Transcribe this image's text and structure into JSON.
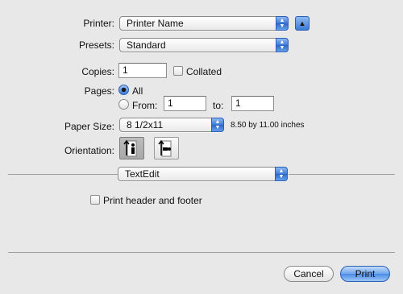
{
  "printer": {
    "label": "Printer:",
    "value": "Printer Name"
  },
  "presets": {
    "label": "Presets:",
    "value": "Standard"
  },
  "copies": {
    "label": "Copies:",
    "value": "1",
    "collated_label": "Collated"
  },
  "pages": {
    "label": "Pages:",
    "all_label": "All",
    "from_label": "From:",
    "from_value": "1",
    "to_label": "to:",
    "to_value": "1"
  },
  "paper_size": {
    "label": "Paper Size:",
    "value": "8 1/2x11",
    "dimensions": "8.50 by 11.00 inches"
  },
  "orientation": {
    "label": "Orientation:"
  },
  "section": {
    "value": "TextEdit"
  },
  "header_footer": {
    "label": "Print header and footer"
  },
  "buttons": {
    "cancel": "Cancel",
    "print": "Print"
  },
  "colors": {
    "accent": "#3b7ad8",
    "background": "#e8e8e8"
  },
  "icons": [
    "disclosure-triangle-icon",
    "popup-arrows-icon",
    "portrait-icon",
    "landscape-icon"
  ]
}
